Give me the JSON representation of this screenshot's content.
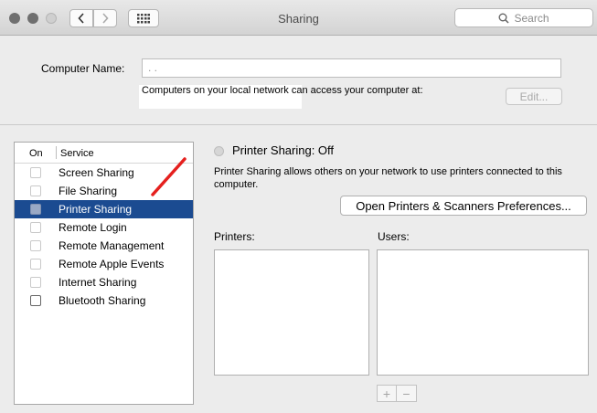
{
  "window": {
    "title": "Sharing",
    "search_placeholder": "Search"
  },
  "computer_name": {
    "label": "Computer Name:",
    "value": ". ."
  },
  "network_info": "Computers on your local network can access your computer at:",
  "edit_button": "Edit...",
  "service_list": {
    "header_on": "On",
    "header_service": "Service",
    "items": [
      {
        "label": "Screen Sharing",
        "checked": false,
        "selected": false
      },
      {
        "label": "File Sharing",
        "checked": false,
        "selected": false
      },
      {
        "label": "Printer Sharing",
        "checked": false,
        "selected": true
      },
      {
        "label": "Remote Login",
        "checked": false,
        "selected": false
      },
      {
        "label": "Remote Management",
        "checked": false,
        "selected": false
      },
      {
        "label": "Remote Apple Events",
        "checked": false,
        "selected": false
      },
      {
        "label": "Internet Sharing",
        "checked": false,
        "selected": false
      },
      {
        "label": "Bluetooth Sharing",
        "checked": false,
        "selected": false
      }
    ]
  },
  "detail": {
    "status": "Printer Sharing: Off",
    "description": "Printer Sharing allows others on your network to use printers connected to this computer.",
    "open_prefs_button": "Open Printers & Scanners Preferences...",
    "printers_label": "Printers:",
    "users_label": "Users:",
    "add_button": "+",
    "remove_button": "−"
  },
  "colors": {
    "selection": "#1b4b91",
    "annotation": "#e5201e"
  }
}
